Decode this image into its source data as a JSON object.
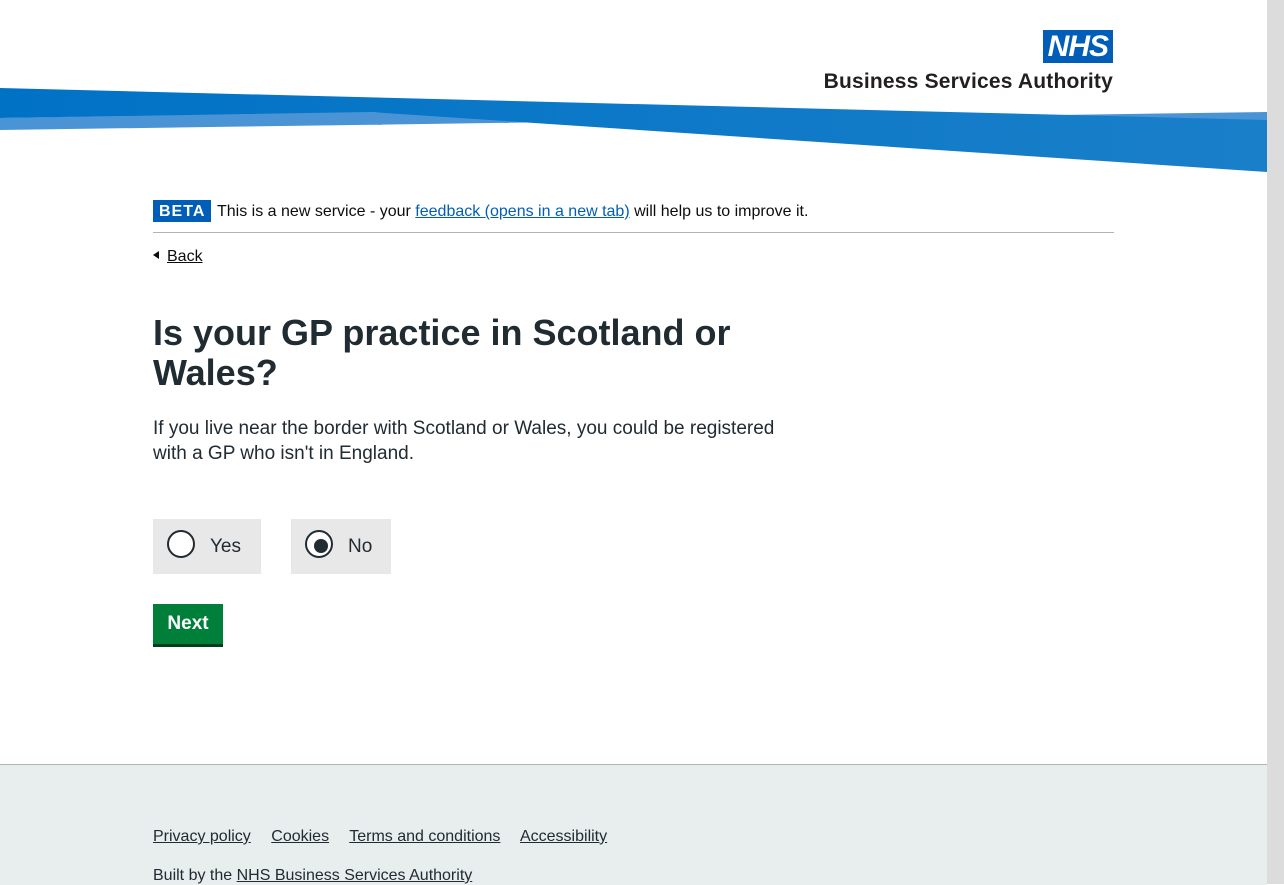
{
  "header": {
    "logo_mark": "NHS",
    "logo_text": "Business Services Authority",
    "brand_color": "#005eb8"
  },
  "beta_banner": {
    "tag": "BETA",
    "text_before": "This is a new service - your",
    "link_text": "feedback (opens in a new tab)",
    "text_after": "will help us to improve it."
  },
  "back_link": {
    "label": "Back",
    "icon": "chevron-left-icon"
  },
  "question": {
    "title": "Is your GP practice in Scotland or Wales?",
    "hint": "If you live near the border with Scotland or Wales, you could be registered with a GP who isn't in England."
  },
  "options": [
    {
      "label": "Yes",
      "selected": false
    },
    {
      "label": "No",
      "selected": true
    }
  ],
  "next_button": {
    "label": "Next",
    "color": "#007f3b"
  },
  "footer": {
    "links": [
      "Privacy policy",
      "Cookies",
      "Terms and conditions",
      "Accessibility"
    ],
    "built_by_prefix": "Built by the",
    "built_by_link": "NHS Business Services Authority"
  }
}
